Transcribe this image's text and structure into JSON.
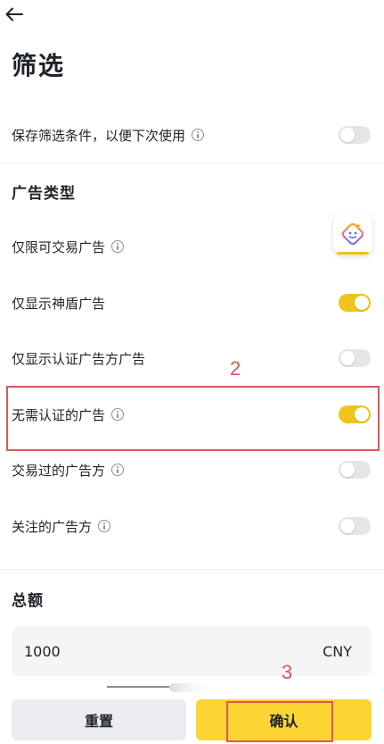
{
  "header": {
    "title": "筛选"
  },
  "save_filter": {
    "label": "保存筛选条件，以便下次使用",
    "enabled": false
  },
  "ad_type": {
    "title": "广告类型",
    "items": [
      {
        "label": "仅限可交易广告",
        "info": true,
        "enabled": null
      },
      {
        "label": "仅显示神盾广告",
        "info": false,
        "enabled": true
      },
      {
        "label": "仅显示认证广告方广告",
        "info": false,
        "enabled": false
      },
      {
        "label": "无需认证的广告",
        "info": true,
        "enabled": true
      },
      {
        "label": "交易过的广告方",
        "info": true,
        "enabled": false
      },
      {
        "label": "关注的广告方",
        "info": true,
        "enabled": false
      }
    ]
  },
  "amount": {
    "title": "总额",
    "value": "1000",
    "currency": "CNY"
  },
  "buttons": {
    "reset": "重置",
    "confirm": "确认"
  },
  "annotations": {
    "box_label": "2",
    "confirm_label": "3"
  },
  "colors": {
    "toggle_on": "#f0c419",
    "toggle_off": "#e4e5e7",
    "confirm_bg": "#fcd535",
    "annotation": "#e05555"
  }
}
